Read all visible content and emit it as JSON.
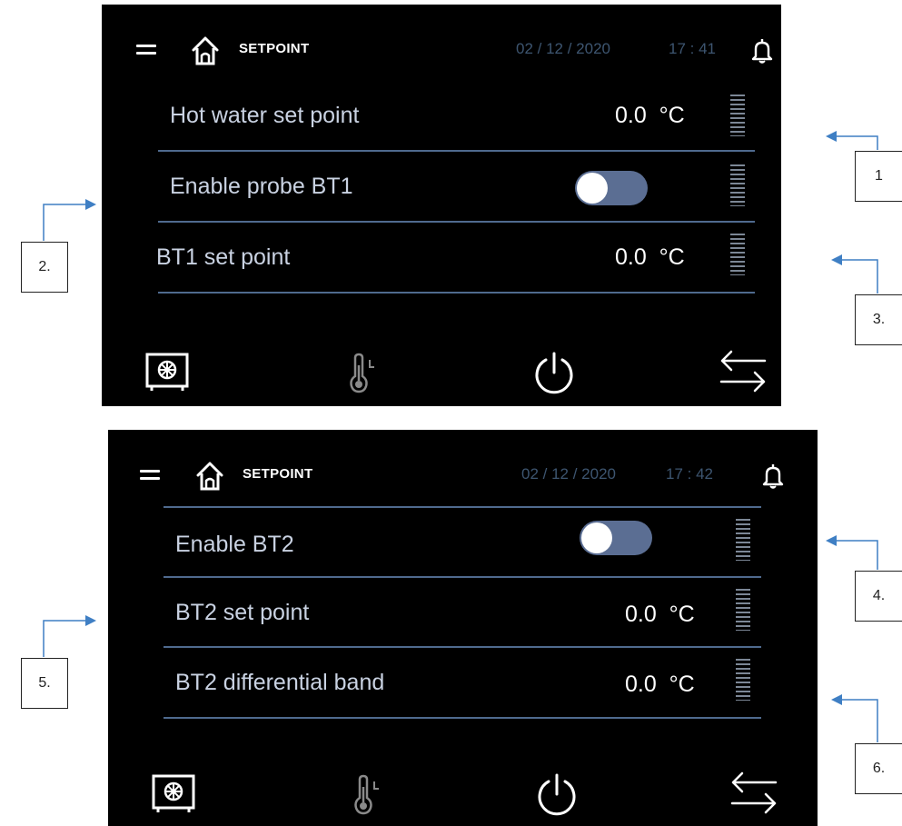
{
  "screens": [
    {
      "header": {
        "title": "SETPOINT",
        "date": "02 / 12 / 2020",
        "time": "17 : 41"
      },
      "rows": [
        {
          "label": "Hot water set point",
          "value": "0.0  °C"
        },
        {
          "label": "Enable probe BT1",
          "toggle": "on"
        },
        {
          "label": "BT1 set point",
          "value": "0.0  °C"
        }
      ]
    },
    {
      "header": {
        "title": "SETPOINT",
        "date": "02 / 12 / 2020",
        "time": "17 : 42"
      },
      "rows": [
        {
          "label": "Enable BT2",
          "toggle": "on"
        },
        {
          "label": "BT2 set point",
          "value": "0.0  °C"
        },
        {
          "label": "BT2 differential band",
          "value": "0.0  °C"
        }
      ]
    }
  ],
  "bottom_nav_icons": [
    "unit-icon",
    "thermometer-icon",
    "power-icon",
    "swap-arrows-icon"
  ],
  "callouts": [
    "1",
    "2.",
    "3.",
    "4.",
    "5.",
    "6."
  ],
  "colors": {
    "screen_bg": "#000000",
    "divider": "#4f6a8e",
    "toggle_track": "#5b6e93",
    "header_muted": "#3d5570",
    "callout_arrow": "#3f7fc4"
  }
}
